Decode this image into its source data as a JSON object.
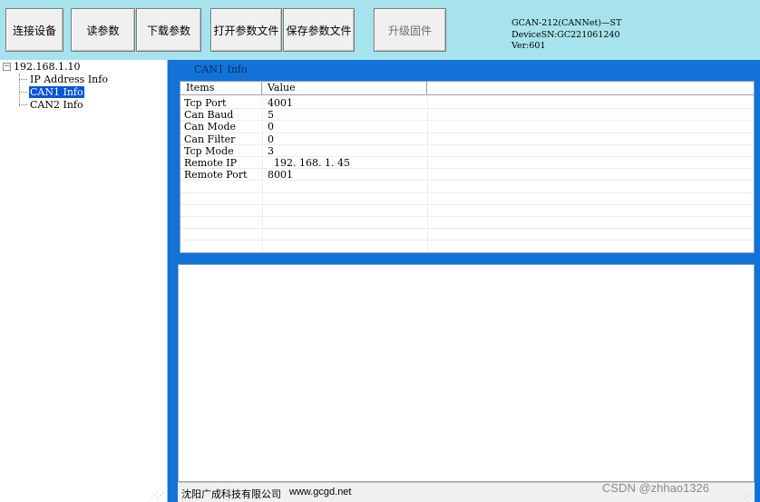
{
  "toolbar": {
    "buttons": [
      {
        "label": "连接设备",
        "enabled": true
      },
      {
        "label": "读参数",
        "enabled": true
      },
      {
        "label": "下载参数",
        "enabled": true
      },
      {
        "label": "打开参数文件",
        "enabled": true
      },
      {
        "label": "保存参数文件",
        "enabled": true
      },
      {
        "label": "升级固件",
        "enabled": false
      }
    ],
    "device_info": {
      "model": "GCAN-212(CANNet)—ST",
      "serial": "DeviceSN:GC221061240",
      "version": "Ver:601"
    }
  },
  "tree": {
    "root": {
      "label": "192.168.1.10",
      "expanded": true
    },
    "children": [
      {
        "label": "IP Address Info",
        "selected": false
      },
      {
        "label": "CAN1 Info",
        "selected": true
      },
      {
        "label": "CAN2 Info",
        "selected": false
      }
    ]
  },
  "info_panel": {
    "title": "CAN1 Info",
    "columns": [
      "Items",
      "Value"
    ],
    "rows": [
      {
        "item": "Tcp Port",
        "value": "4001"
      },
      {
        "item": "Can Baud",
        "value": "5"
      },
      {
        "item": "Can Mode",
        "value": "0"
      },
      {
        "item": "Can Filter",
        "value": "0"
      },
      {
        "item": "Tcp Mode",
        "value": "3"
      },
      {
        "item": "Remote IP",
        "value": "  192. 168. 1. 45"
      },
      {
        "item": "Remote Port",
        "value": "8001"
      }
    ]
  },
  "statusbar": {
    "company": "沈阳广成科技有限公司",
    "website": "www.gcgd.net"
  },
  "watermark": "CSDN @zhhao1326",
  "colors": {
    "toolbar_bg": "#a6e3ec",
    "panel_blue": "#1272d8",
    "selection": "#0a55d8"
  }
}
